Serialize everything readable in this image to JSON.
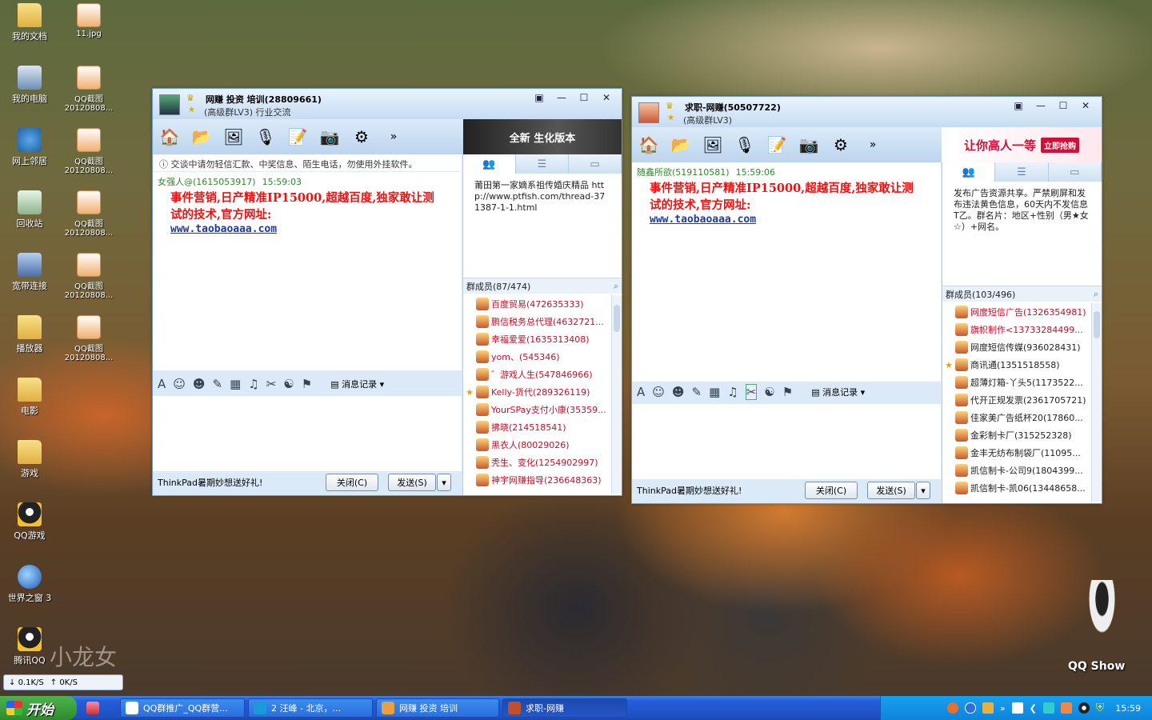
{
  "desktop": {
    "icons": [
      {
        "label": "我的文档",
        "icon": "folder-icon"
      },
      {
        "label": "我的电脑",
        "icon": "computer-icon"
      },
      {
        "label": "网上邻居",
        "icon": "network-icon"
      },
      {
        "label": "回收站",
        "icon": "recycle-bin-icon"
      },
      {
        "label": "宽带连接",
        "icon": "broadband-icon"
      },
      {
        "label": "播放器",
        "icon": "folder-icon"
      },
      {
        "label": "电影",
        "icon": "folder-icon"
      },
      {
        "label": "游戏",
        "icon": "folder-icon"
      },
      {
        "label": "QQ游戏",
        "icon": "qq-game-icon"
      },
      {
        "label": "世界之窗 3",
        "icon": "browser-icon"
      },
      {
        "label": "腾讯QQ",
        "icon": "qq-icon"
      }
    ],
    "files": [
      {
        "label": "11.jpg"
      },
      {
        "label": "QQ截图20120808..."
      },
      {
        "label": "QQ截图20120808..."
      },
      {
        "label": "QQ截图20120808..."
      },
      {
        "label": "QQ截图20120808..."
      },
      {
        "label": "QQ截图20120808..."
      }
    ],
    "net_down": "0.1K/S",
    "net_up": "0K/S",
    "watermark": "小龙女",
    "qq_show": "QQ Show"
  },
  "win1": {
    "title": "网赚 投资 培训(28809661)",
    "subtitle": "(高级群LV3) 行业交流",
    "ad_text": "全新 生化版本",
    "notice": "交谈中请勿轻信汇款、中奖信息、陌生电话，勿使用外挂软件。",
    "sender": "女强人@(1615053917)",
    "time": "15:59:03",
    "message": "事件营销,日产精准IP15000,超越百度,独家敢让测试的技术,官方网址:",
    "link": "www.taobaoaaa.com",
    "announcement": "莆田第一家嫡系祖传婚庆精品 http://www.ptfish.com/thread-371387-1-1.html",
    "members_header": "群成员(87/474)",
    "members": [
      {
        "name": "百度贸易(472635333)",
        "color": "#c0102a"
      },
      {
        "name": "鹏信税务总代理(4632721...",
        "color": "#c0102a"
      },
      {
        "name": "幸福爱爱(1635313408)",
        "color": "#c0102a"
      },
      {
        "name": "yom、(545346)",
        "color": "#c0102a"
      },
      {
        "name": "゛游戏人生(547846966)",
        "color": "#c0102a"
      },
      {
        "name": "Kelly-货代(289326119)",
        "color": "#c0102a",
        "star": true
      },
      {
        "name": "YourSPay支付小康(35359...",
        "color": "#c0102a"
      },
      {
        "name": "拂晓(214518541)",
        "color": "#c0102a"
      },
      {
        "name": "黑衣人(80029026)",
        "color": "#c0102a"
      },
      {
        "name": "秃生、变化(1254902997)",
        "color": "#c0102a"
      },
      {
        "name": "神宇网赚指导(236648363)",
        "color": "#c0102a"
      }
    ],
    "history": "消息记录",
    "ad_footer": "ThinkPad暑期妙想送好礼!",
    "close_btn": "关闭(C)",
    "send_btn": "发送(S)"
  },
  "win2": {
    "title": "求职-网赚(50507722)",
    "subtitle": "(高级群LV3)",
    "ad_text": "让你高人一等",
    "ad_button": "立即抢购",
    "sender": "随鑫所欲(519110581)",
    "time": "15:59:06",
    "message": "事件营销,日产精准IP15000,超越百度,独家敢让测试的技术,官方网址:",
    "link": "www.taobaoaaa.com",
    "announcement": "发布广告资源共享。严禁刷屏和发布违法黄色信息，60天内不发信息T乙。群名片：地区+性别（男★女☆）+网名。",
    "members_header": "群成员(103/496)",
    "members": [
      {
        "name": "网度短信广告(1326354981)",
        "color": "#c0102a"
      },
      {
        "name": "旗帜制作<13733284499...",
        "color": "#c0102a"
      },
      {
        "name": "网度短信传媒(936028431)",
        "color": "#222"
      },
      {
        "name": "商讯通(1351518558)",
        "color": "#222",
        "star": true
      },
      {
        "name": "超薄灯箱-丫头5(1173522...",
        "color": "#222"
      },
      {
        "name": "代开正规发票(2361705721)",
        "color": "#222"
      },
      {
        "name": "佳家美广告纸杯20(17860...",
        "color": "#222"
      },
      {
        "name": "金彩制卡厂(315252328)",
        "color": "#222"
      },
      {
        "name": "金丰无纺布制袋厂(11095...",
        "color": "#222"
      },
      {
        "name": "凯信制卡-公司9(1804399...",
        "color": "#222"
      },
      {
        "name": "凯信制卡-凯06(13448658...",
        "color": "#222"
      }
    ],
    "history": "消息记录",
    "ad_footer": "ThinkPad暑期妙想送好礼!",
    "close_btn": "关闭(C)",
    "send_btn": "发送(S)"
  },
  "taskbar": {
    "start": "开始",
    "tasks": [
      {
        "label": "QQ群推广_QQ群营..."
      },
      {
        "label": "2 汪峰 - 北京，..."
      },
      {
        "label": "网赚 投资 培训"
      },
      {
        "label": "求职-网赚"
      }
    ],
    "clock": "15:59"
  }
}
